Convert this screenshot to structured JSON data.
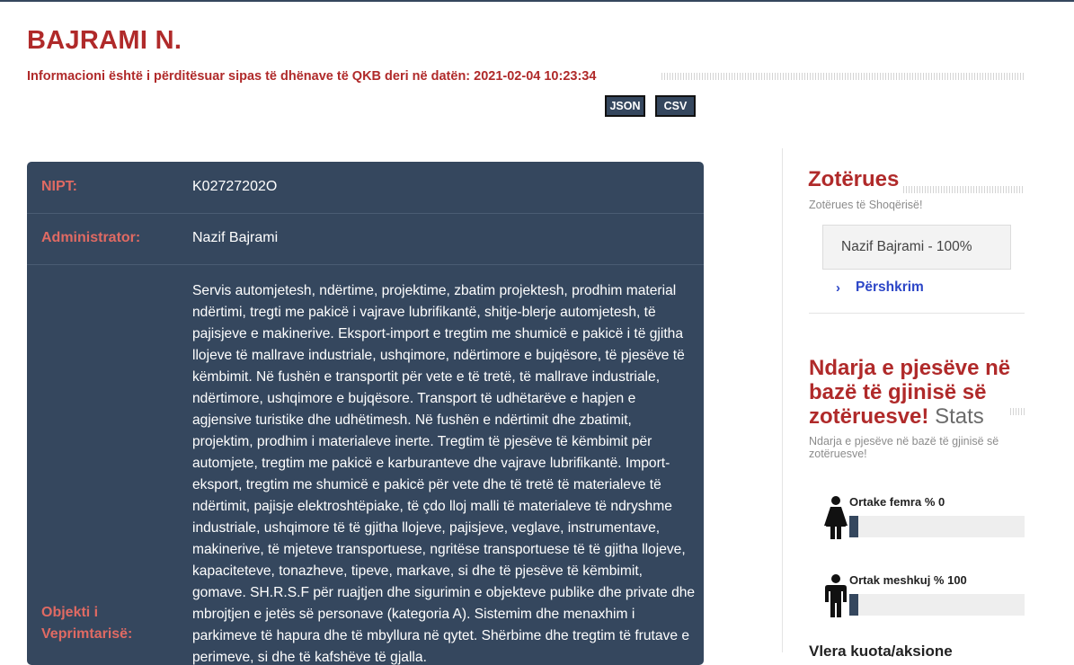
{
  "company": {
    "name": "BAJRAMI N.",
    "update_note": "Informacioni është i përditësuar sipas të dhënave të QKB deri në datën: 2021-02-04 10:23:34"
  },
  "export": {
    "json_label": "JSON",
    "csv_label": "CSV"
  },
  "details": {
    "nipt_label": "NIPT:",
    "nipt_value": "K02727202O",
    "admin_label": "Administrator:",
    "admin_value": "Nazif Bajrami",
    "activity_label": "Objekti i Veprimtarisë:",
    "activity_value": "Servis automjetesh, ndërtime, projektime, zbatim projektesh, prodhim material ndërtimi, tregti me pakicë i vajrave lubrifikantë, shitje-blerje automjetesh, të pajisjeve e makinerive. Eksport-import e tregtim me shumicë e pakicë i të gjitha llojeve të mallrave industriale, ushqimore, ndërtimore e bujqësore, të pjesëve të këmbimit. Në fushën e transportit për vete e të tretë, të mallrave industriale, ndërtimore, ushqimore e bujqësore. Transport të udhëtarëve e hapjen e agjensive turistike dhe udhëtimesh. Në fushën e ndërtimit dhe zbatimit, projektim, prodhim i materialeve inerte. Tregtim të pjesëve të këmbimit për automjete, tregtim me pakicë e karburanteve dhe vajrave lubrifikantë. Import-eksport, tregtim me shumicë e pakicë për vete dhe të tretë të materialeve të ndërtimit, pajisje elektroshtëpiake, të çdo lloj malli të materialeve të ndryshme industriale, ushqimore të të gjitha llojeve, pajisjeve, veglave, instrumentave, makinerive, të mjeteve transportuese, ngritëse transportuese të të gjitha llojeve, kapaciteteve, tonazheve, tipeve, markave, si dhe të pjesëve të këmbimit, gomave. SH.R.S.F për ruajtjen dhe sigurimin e objekteve publike dhe private dhe mbrojtjen e jetës së personave (kategoria A). Sistemim dhe menaxhim i parkimeve të hapura dhe të mbyllura në qytet. Shërbime dhe tregtim të frutave e perimeve, si dhe të kafshëve të gjalla."
  },
  "owners": {
    "title": "Zotërues",
    "subtitle": "Zotërues të Shoqërisë!",
    "items": [
      {
        "text": "Nazif Bajrami - 100%"
      }
    ],
    "description_link": "Përshkrim"
  },
  "gender": {
    "title_strong": "Ndarja e pjesëve në bazë të gjinisë së zotëruesve!",
    "title_light": "Stats",
    "subtitle": "Ndarja e pjesëve në bazë të gjinisë së zotëruesve!",
    "female_label": "Ortake femra % 0",
    "female_percent": 0,
    "male_label": "Ortak meshkuj % 100",
    "male_percent": 100
  },
  "shares": {
    "title": "Vlera kuota/aksione"
  },
  "colors": {
    "brand_red": "#b02a2a",
    "panel_navy": "#35475e",
    "link_blue": "#2c46c7"
  },
  "icons": {
    "female": "female-person-icon",
    "male": "male-person-icon",
    "chevron": "chevron-right-icon"
  }
}
